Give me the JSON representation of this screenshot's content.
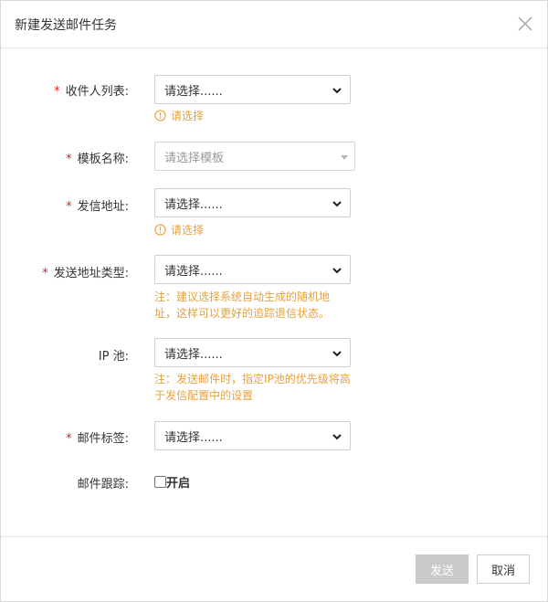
{
  "dialog": {
    "title": "新建发送邮件任务",
    "close_icon": "close-icon"
  },
  "form": {
    "recipient_list": {
      "required": "*",
      "label": "收件人列表:",
      "value": "请选择......",
      "error": "请选择"
    },
    "template_name": {
      "required": "*",
      "label": "模板名称:",
      "placeholder": "请选择模板"
    },
    "sender_address": {
      "required": "*",
      "label": "发信地址:",
      "value": "请选择......",
      "error": "请选择"
    },
    "address_type": {
      "required": "*",
      "label": "发送地址类型:",
      "value": "请选择......",
      "note": "注：建议选择系统自动生成的随机地址，这样可以更好的追踪退信状态。"
    },
    "ip_pool": {
      "label": "IP 池:",
      "value": "请选择......",
      "note": "注：发送邮件时，指定IP池的优先级将高于发信配置中的设置"
    },
    "mail_tag": {
      "required": "*",
      "label": "邮件标签:",
      "value": "请选择......"
    },
    "mail_tracking": {
      "label": "邮件跟踪:",
      "checkbox_label": "开启"
    }
  },
  "footer": {
    "send_label": "发送",
    "cancel_label": "取消"
  },
  "colors": {
    "required": "#e02020",
    "warning": "#e6a23c",
    "disabled_button": "#c9c9c9"
  }
}
